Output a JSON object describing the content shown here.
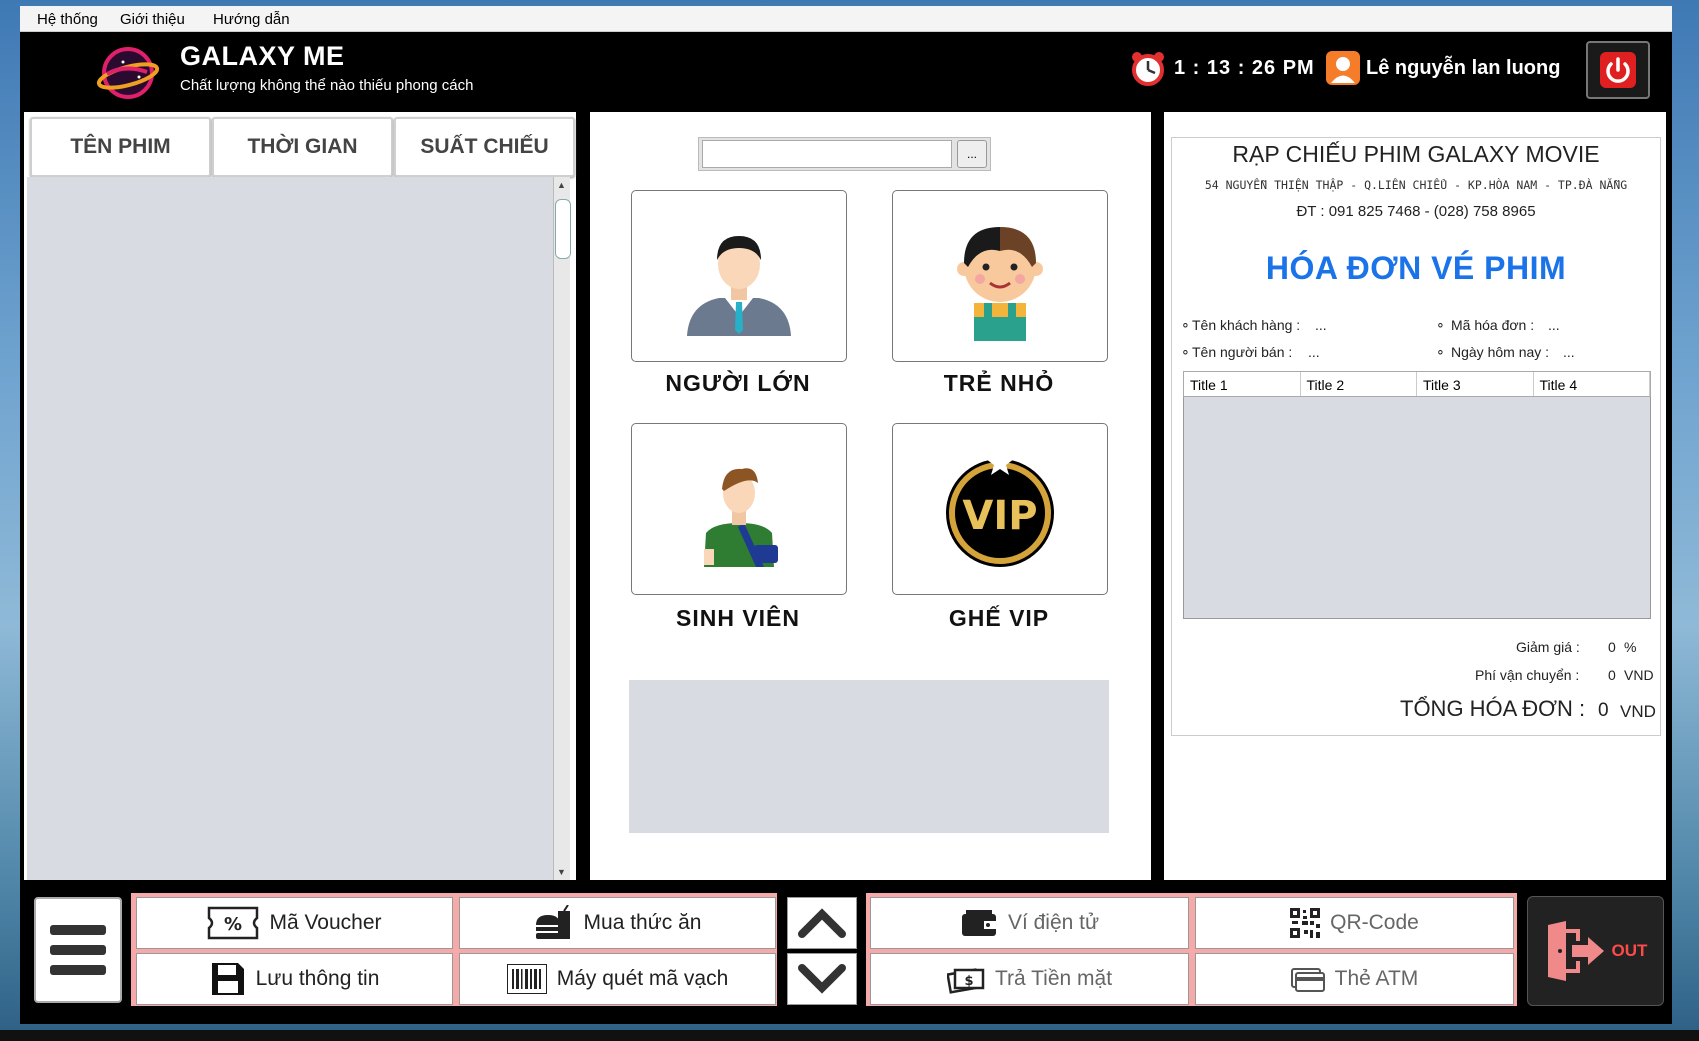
{
  "menubar": {
    "items": [
      "Hệ thống",
      "Giới thiệu",
      "Hướng dẫn"
    ]
  },
  "header": {
    "title": "GALAXY ME",
    "slogan": "Chất lượng không thể nào thiếu phong cách",
    "clock": "1 : 13 : 26 PM",
    "user": "Lê nguyễn lan luong"
  },
  "tabs": [
    "TÊN PHIM",
    "THỜI GIAN",
    "SUẤT CHIẾU"
  ],
  "search": {
    "value": "",
    "button": "..."
  },
  "tickets": [
    {
      "label": "NGƯỜI LỚN",
      "icon": "adult-man-icon"
    },
    {
      "label": "TRẺ NHỎ",
      "icon": "child-icon"
    },
    {
      "label": "SINH VIÊN",
      "icon": "student-icon"
    },
    {
      "label": "GHẾ VIP",
      "icon": "vip-badge-icon",
      "badge_text": "VIP"
    }
  ],
  "invoice": {
    "cinema_name": "RẠP CHIẾU PHIM GALAXY MOVIE",
    "address": "54 NGUYỄN THIỆN THẬP - Q.LIÊN CHIỂU - KP.HÒA NAM - TP.ĐÀ NẴNG",
    "phone": "ĐT : 091 825 7468 - (028) 758 8965",
    "title": "HÓA ĐƠN VÉ PHIM",
    "customer_label": "Tên khách hàng :",
    "customer_value": "...",
    "invoice_no_label": "Mã hóa đơn :",
    "invoice_no_value": "...",
    "seller_label": "Tên người bán :",
    "seller_value": "...",
    "date_label": "Ngày hôm nay :",
    "date_value": "...",
    "columns": [
      "Title 1",
      "Title 2",
      "Title 3",
      "Title 4"
    ],
    "discount_label": "Giảm giá :",
    "discount_value": "0",
    "discount_unit": "%",
    "shipping_label": "Phí vận chuyển :",
    "shipping_value": "0",
    "shipping_unit": "VND",
    "total_label": "TỔNG HÓA ĐƠN :",
    "total_value": "0",
    "total_unit": "VND"
  },
  "toolbar": {
    "voucher": "Mã Voucher",
    "food": "Mua thức ăn",
    "save": "Lưu thông tin",
    "barcode": "Máy quét mã vạch",
    "ewallet": "Ví điện tử",
    "qrcode": "QR-Code",
    "cash": "Trả Tiền mặt",
    "atm": "Thẻ ATM",
    "out": "OUT"
  },
  "colors": {
    "accent_blue": "#1a73e8",
    "toolbar_group": "#f5a9a9",
    "power_red": "#e02020"
  }
}
